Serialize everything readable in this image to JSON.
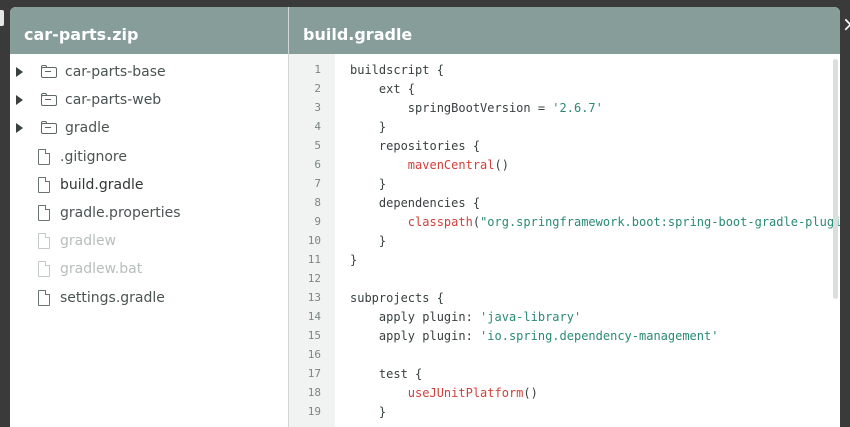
{
  "left_panel": {
    "title": "car-parts.zip",
    "items": [
      {
        "label": "car-parts-base",
        "kind": "folder",
        "state": "normal"
      },
      {
        "label": "car-parts-web",
        "kind": "folder",
        "state": "normal"
      },
      {
        "label": "gradle",
        "kind": "folder",
        "state": "normal"
      },
      {
        "label": ".gitignore",
        "kind": "file",
        "state": "normal"
      },
      {
        "label": "build.gradle",
        "kind": "file",
        "state": "active"
      },
      {
        "label": "gradle.properties",
        "kind": "file",
        "state": "normal"
      },
      {
        "label": "gradlew",
        "kind": "file",
        "state": "dim"
      },
      {
        "label": "gradlew.bat",
        "kind": "file",
        "state": "dim"
      },
      {
        "label": "settings.gradle",
        "kind": "file",
        "state": "normal"
      }
    ]
  },
  "right_panel": {
    "title": "build.gradle",
    "lines": [
      {
        "n": "1",
        "segs": [
          {
            "t": "buildscript {",
            "c": "plain"
          }
        ]
      },
      {
        "n": "2",
        "segs": [
          {
            "t": "    ext {",
            "c": "plain"
          }
        ]
      },
      {
        "n": "3",
        "segs": [
          {
            "t": "        springBootVersion = ",
            "c": "plain"
          },
          {
            "t": "'2.6.7'",
            "c": "str"
          }
        ]
      },
      {
        "n": "4",
        "segs": [
          {
            "t": "    }",
            "c": "plain"
          }
        ]
      },
      {
        "n": "5",
        "segs": [
          {
            "t": "    repositories {",
            "c": "plain"
          }
        ]
      },
      {
        "n": "6",
        "segs": [
          {
            "t": "        ",
            "c": "plain"
          },
          {
            "t": "mavenCentral",
            "c": "fn"
          },
          {
            "t": "()",
            "c": "plain"
          }
        ]
      },
      {
        "n": "7",
        "segs": [
          {
            "t": "    }",
            "c": "plain"
          }
        ]
      },
      {
        "n": "8",
        "segs": [
          {
            "t": "    dependencies {",
            "c": "plain"
          }
        ]
      },
      {
        "n": "9",
        "segs": [
          {
            "t": "        ",
            "c": "plain"
          },
          {
            "t": "classpath",
            "c": "fn"
          },
          {
            "t": "(",
            "c": "plain"
          },
          {
            "t": "\"org.springframework.boot:spring-boot-gradle-plugin",
            "c": "str"
          }
        ]
      },
      {
        "n": "10",
        "segs": [
          {
            "t": "    }",
            "c": "plain"
          }
        ]
      },
      {
        "n": "11",
        "segs": [
          {
            "t": "}",
            "c": "plain"
          }
        ]
      },
      {
        "n": "12",
        "segs": []
      },
      {
        "n": "13",
        "segs": [
          {
            "t": "subprojects {",
            "c": "plain"
          }
        ]
      },
      {
        "n": "14",
        "segs": [
          {
            "t": "    apply plugin: ",
            "c": "plain"
          },
          {
            "t": "'java-library'",
            "c": "str"
          }
        ]
      },
      {
        "n": "15",
        "segs": [
          {
            "t": "    apply plugin: ",
            "c": "plain"
          },
          {
            "t": "'io.spring.dependency-management'",
            "c": "str"
          }
        ]
      },
      {
        "n": "16",
        "segs": []
      },
      {
        "n": "17",
        "segs": [
          {
            "t": "    test {",
            "c": "plain"
          }
        ]
      },
      {
        "n": "18",
        "segs": [
          {
            "t": "        ",
            "c": "plain"
          },
          {
            "t": "useJUnitPlatform",
            "c": "fn"
          },
          {
            "t": "()",
            "c": "plain"
          }
        ]
      },
      {
        "n": "19",
        "segs": [
          {
            "t": "    }",
            "c": "plain"
          }
        ]
      }
    ]
  },
  "close_label": "×",
  "colors": {
    "header_bg": "#869d9a",
    "string": "#2a8a76",
    "function": "#d0403a",
    "gutter_bg": "#f1f3f3"
  }
}
